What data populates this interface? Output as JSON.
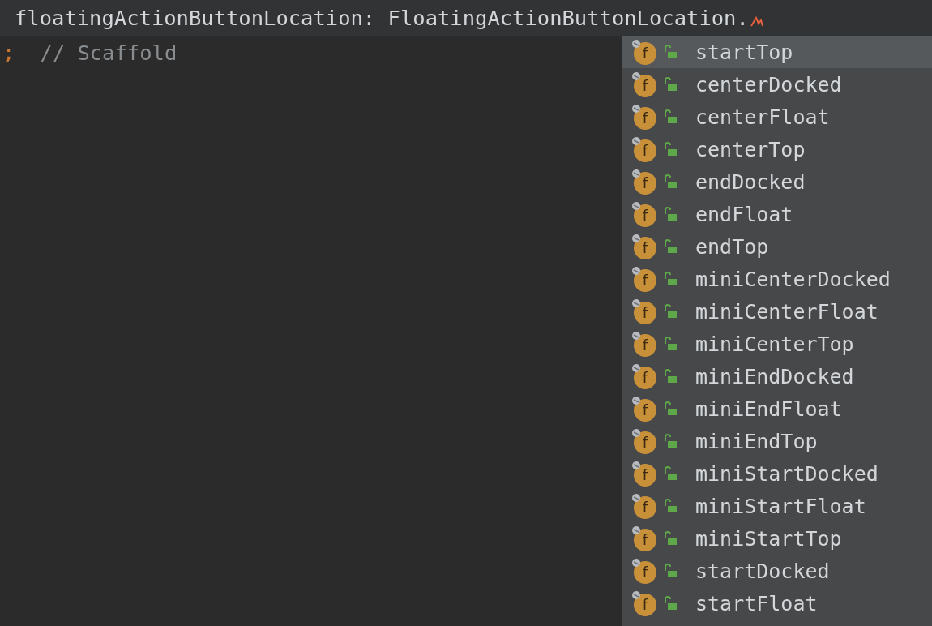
{
  "editor": {
    "lines": [
      {
        "current": true,
        "error_mark": true,
        "tokens": [
          {
            "kind": "plain",
            "text": "floatingActionButtonLocation: FloatingActionButtonLocation."
          }
        ]
      },
      {
        "current": false,
        "error_mark": false,
        "tokens": [
          {
            "kind": "keyword",
            "text": ";"
          },
          {
            "kind": "comment",
            "text": "// Scaffold"
          }
        ]
      }
    ]
  },
  "completion_popup": {
    "items": [
      {
        "icon": "f",
        "label": "startTop",
        "selected": true
      },
      {
        "icon": "f",
        "label": "centerDocked",
        "selected": false
      },
      {
        "icon": "f",
        "label": "centerFloat",
        "selected": false
      },
      {
        "icon": "f",
        "label": "centerTop",
        "selected": false
      },
      {
        "icon": "f",
        "label": "endDocked",
        "selected": false
      },
      {
        "icon": "f",
        "label": "endFloat",
        "selected": false
      },
      {
        "icon": "f",
        "label": "endTop",
        "selected": false
      },
      {
        "icon": "f",
        "label": "miniCenterDocked",
        "selected": false
      },
      {
        "icon": "f",
        "label": "miniCenterFloat",
        "selected": false
      },
      {
        "icon": "f",
        "label": "miniCenterTop",
        "selected": false
      },
      {
        "icon": "f",
        "label": "miniEndDocked",
        "selected": false
      },
      {
        "icon": "f",
        "label": "miniEndFloat",
        "selected": false
      },
      {
        "icon": "f",
        "label": "miniEndTop",
        "selected": false
      },
      {
        "icon": "f",
        "label": "miniStartDocked",
        "selected": false
      },
      {
        "icon": "f",
        "label": "miniStartFloat",
        "selected": false
      },
      {
        "icon": "f",
        "label": "miniStartTop",
        "selected": false
      },
      {
        "icon": "f",
        "label": "startDocked",
        "selected": false
      },
      {
        "icon": "f",
        "label": "startFloat",
        "selected": false
      }
    ]
  }
}
